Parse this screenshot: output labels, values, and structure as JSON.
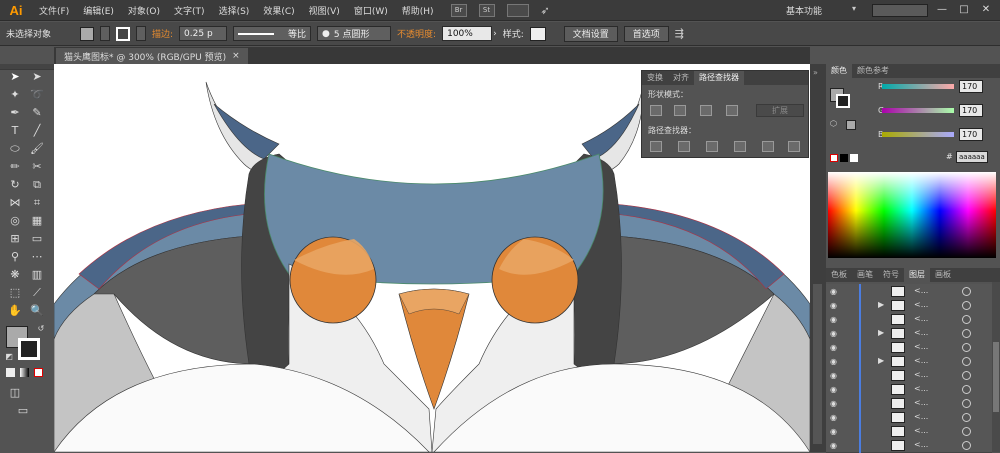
{
  "app": {
    "logo": "Ai"
  },
  "menubar": {
    "items": [
      "文件(F)",
      "编辑(E)",
      "对象(O)",
      "文字(T)",
      "选择(S)",
      "效果(C)",
      "视图(V)",
      "窗口(W)",
      "帮助(H)"
    ],
    "br_icon": "Br",
    "st_icon": "St",
    "workspace_label": "基本功能",
    "win_min": "—",
    "win_max": "□",
    "win_close": "✕"
  },
  "controlbar": {
    "selection_label": "未选择对象",
    "stroke_label": "描边:",
    "stroke_value": "0.25 p",
    "stroke_profile": "等比",
    "brush_value": "5 点圆形",
    "opacity_label": "不透明度:",
    "opacity_value": "100%",
    "style_label": "样式:",
    "doc_setup_button": "文档设置",
    "preferences_button": "首选项"
  },
  "document": {
    "tab_title": "猫头鹰图标* @ 300% (RGB/GPU 预览)",
    "tab_close": "×"
  },
  "pathfinder": {
    "tabs": [
      "变换",
      "对齐",
      "路径查找器"
    ],
    "shape_modes_label": "形状模式：",
    "pathfinders_label": "路径查找器：",
    "expand_button": "扩展"
  },
  "color": {
    "tabs": [
      "颜色",
      "颜色参考"
    ],
    "r_label": "R",
    "r_value": "170",
    "g_label": "G",
    "g_value": "170",
    "b_label": "B",
    "b_value": "170",
    "hex_value": "aaaaaa",
    "hex_prefix": "#"
  },
  "layers": {
    "tabs": [
      "色板",
      "画笔",
      "符号",
      "图层",
      "画板"
    ],
    "rows": [
      {
        "name": "<...",
        "expand": ""
      },
      {
        "name": "<...",
        "expand": "▶"
      },
      {
        "name": "<...",
        "expand": ""
      },
      {
        "name": "<...",
        "expand": "▶"
      },
      {
        "name": "<...",
        "expand": ""
      },
      {
        "name": "<...",
        "expand": "▶"
      },
      {
        "name": "<...",
        "expand": ""
      },
      {
        "name": "<...",
        "expand": ""
      },
      {
        "name": "<...",
        "expand": ""
      },
      {
        "name": "<...",
        "expand": ""
      },
      {
        "name": "<...",
        "expand": ""
      },
      {
        "name": "<...",
        "expand": ""
      }
    ]
  },
  "colors": {
    "accent": "#ff9a00",
    "owl_blue_light": "#6b8aa6",
    "owl_blue_dark": "#4b6688",
    "owl_orange": "#e0883a",
    "owl_orange_light": "#e9a563",
    "owl_dark": "#444444",
    "owl_mid": "#5e5e5e",
    "owl_grey": "#c4c4c4"
  }
}
